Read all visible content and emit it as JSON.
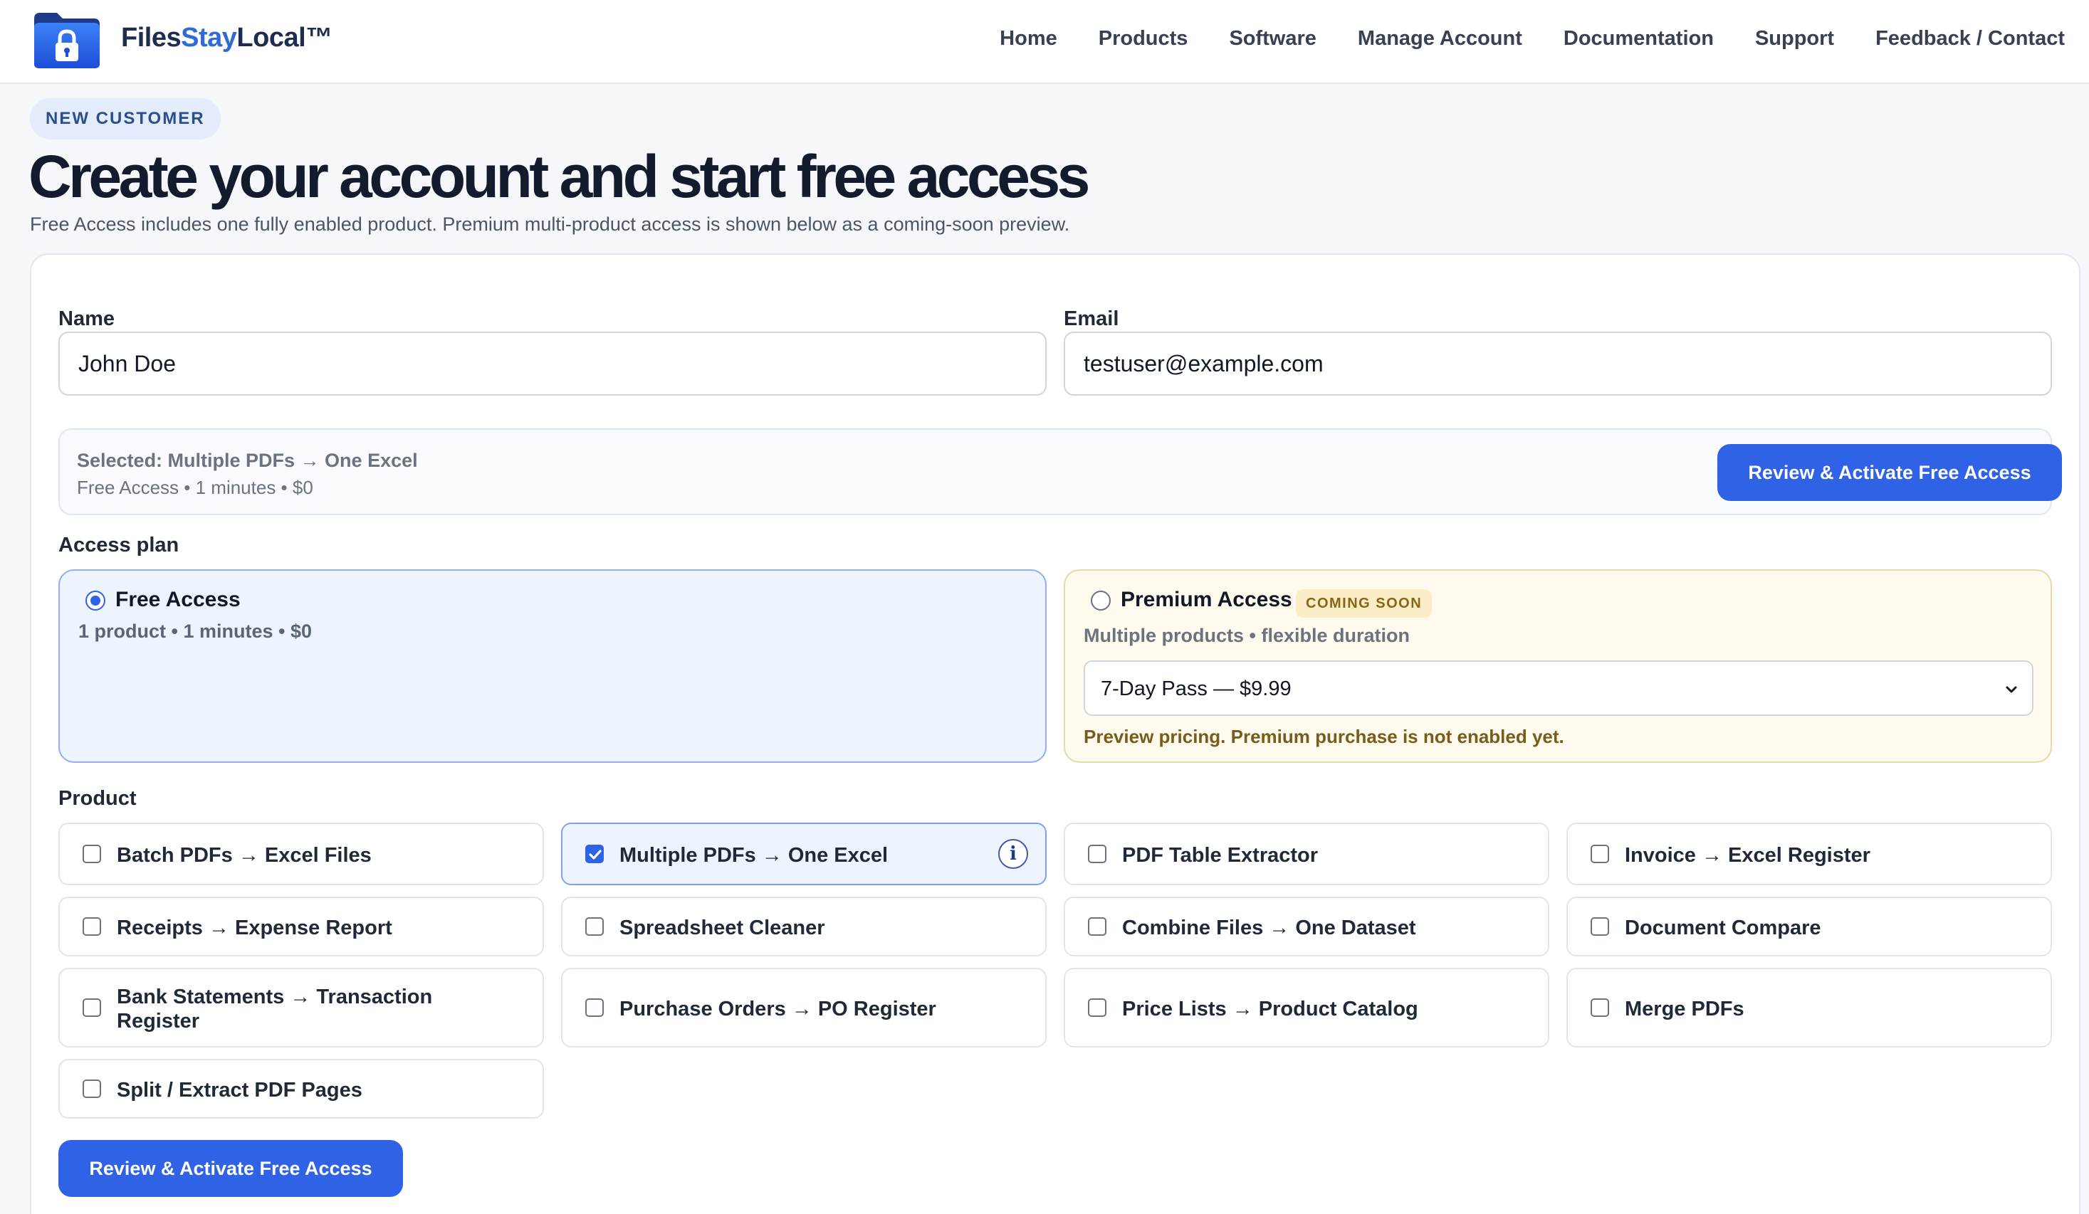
{
  "header": {
    "brand_part1": "Files",
    "brand_part2": "Stay",
    "brand_part3": "Local™",
    "nav": [
      "Home",
      "Products",
      "Software",
      "Manage Account",
      "Documentation",
      "Support",
      "Feedback / Contact"
    ]
  },
  "intro": {
    "badge": "NEW CUSTOMER",
    "title": "Create your account and start free access",
    "subtitle": "Free Access includes one fully enabled product. Premium multi-product access is shown below as a coming-soon preview."
  },
  "form": {
    "name_label": "Name",
    "name_value": "John Doe",
    "email_label": "Email",
    "email_value": "testuser@example.com"
  },
  "summary": {
    "selected_text": "Selected: Multiple PDFs → One Excel",
    "details": "Free Access • 1 minutes • $0",
    "cta_label": "Review & Activate Free Access"
  },
  "access_plan": {
    "label": "Access plan",
    "free": {
      "title": "Free Access",
      "meta": "1 product • 1 minutes • $0",
      "selected": true
    },
    "premium": {
      "title": "Premium Access",
      "badge": "COMING SOON",
      "meta": "Multiple products • flexible duration",
      "selected_option": "7-Day Pass — $9.99",
      "note": "Preview pricing. Premium purchase is not enabled yet."
    }
  },
  "products": {
    "label": "Product",
    "items": [
      {
        "label": "Batch PDFs → Excel Files",
        "checked": false
      },
      {
        "label": "Multiple PDFs → One Excel",
        "checked": true
      },
      {
        "label": "PDF Table Extractor",
        "checked": false
      },
      {
        "label": "Invoice → Excel Register",
        "checked": false
      },
      {
        "label": "Receipts → Expense Report",
        "checked": false
      },
      {
        "label": "Spreadsheet Cleaner",
        "checked": false
      },
      {
        "label": "Combine Files → One Dataset",
        "checked": false
      },
      {
        "label": "Document Compare",
        "checked": false
      },
      {
        "label": "Bank Statements → Transaction Register",
        "checked": false
      },
      {
        "label": "Purchase Orders → PO Register",
        "checked": false
      },
      {
        "label": "Price Lists → Product Catalog",
        "checked": false
      },
      {
        "label": "Merge PDFs",
        "checked": false
      },
      {
        "label": "Split / Extract PDF Pages",
        "checked": false
      }
    ],
    "info_glyph": "i"
  },
  "bottom_cta_label": "Review & Activate Free Access",
  "colors": {
    "accent": "#2f62e4",
    "brand_blue": "#2f6bd8",
    "brand_dark": "#1e2d4f",
    "premium_bg": "#fffaee"
  },
  "icons": {
    "logo": "folder-lock-icon",
    "select": "chevron-down-icon",
    "check": "checkmark-icon",
    "info": "info-icon"
  }
}
